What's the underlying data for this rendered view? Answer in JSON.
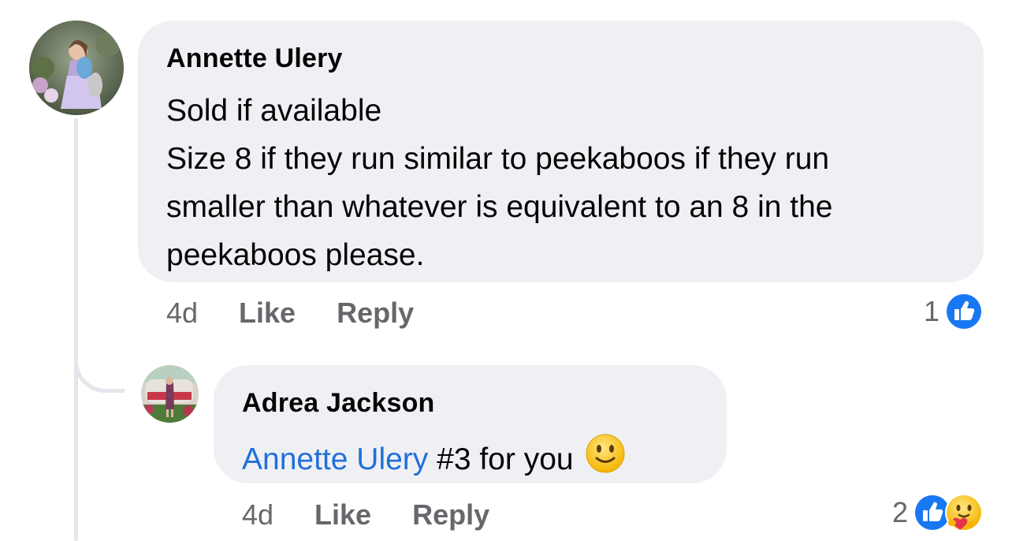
{
  "comments": [
    {
      "author": "Annette Ulery",
      "lines": [
        "Sold if available",
        "Size 8 if they run similar to peekaboos if they run",
        "smaller than whatever is equivalent to an 8 in the",
        "peekaboos please."
      ],
      "time": "4d",
      "like_label": "Like",
      "reply_label": "Reply",
      "reaction_count": "1",
      "reactions": [
        "like-icon"
      ]
    },
    {
      "author": "Adrea Jackson",
      "mention": "Annette Ulery",
      "text": " #3 for you",
      "emoji": "slightly-smiling-face-icon",
      "time": "4d",
      "like_label": "Like",
      "reply_label": "Reply",
      "reaction_count": "2",
      "reactions": [
        "like-icon",
        "care-icon"
      ]
    }
  ],
  "colors": {
    "bubble": "#eff0f4",
    "mention": "#216fdb",
    "secondary_text": "#65676b",
    "like_blue": "#1877f2",
    "thread_line": "#e4e6eb"
  }
}
